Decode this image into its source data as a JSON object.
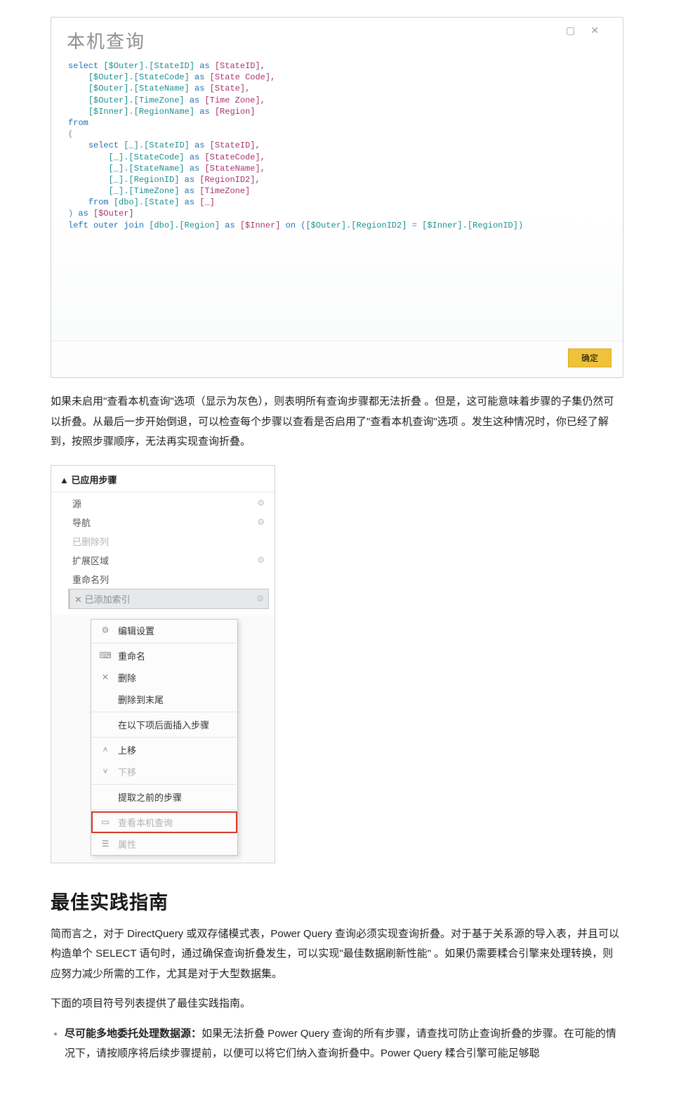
{
  "dialog": {
    "title": "本机查询",
    "win_square": "▢",
    "win_close": "✕",
    "ok_label": "确定",
    "sql": {
      "l01a": "select ",
      "l01b": "[$Outer].[StateID] ",
      "l01c": "as ",
      "l01d": "[StateID],",
      "l02a": "[$Outer].[StateCode] ",
      "l02b": "as ",
      "l02c": "[State Code],",
      "l03a": "[$Outer].[StateName] ",
      "l03b": "as ",
      "l03c": "[State],",
      "l04a": "[$Outer].[TimeZone] ",
      "l04b": "as ",
      "l04c": "[Time Zone],",
      "l05a": "[$Inner].[RegionName] ",
      "l05b": "as ",
      "l05c": "[Region]",
      "l06": "from",
      "l07": "(",
      "l08a": "select ",
      "l08b": "[_].[StateID] ",
      "l08c": "as ",
      "l08d": "[StateID],",
      "l09a": "[_].[StateCode] ",
      "l09b": "as ",
      "l09c": "[StateCode],",
      "l10a": "[_].[StateName] ",
      "l10b": "as ",
      "l10c": "[StateName],",
      "l11a": "[_].[RegionID] ",
      "l11b": "as ",
      "l11c": "[RegionID2],",
      "l12a": "[_].[TimeZone] ",
      "l12b": "as ",
      "l12c": "[TimeZone]",
      "l13a": "from ",
      "l13b": "[dbo].[State] ",
      "l13c": "as ",
      "l13d": "[_]",
      "l14a": ") ",
      "l14b": "as ",
      "l14c": "[$Outer]",
      "l15a": "left outer join ",
      "l15b": "[dbo].[Region] ",
      "l15c": "as ",
      "l15d": "[$Inner] ",
      "l15e": "on (",
      "l15f": "[$Outer].[RegionID2] ",
      "l15g": "= ",
      "l15h": "[$Inner].[RegionID])"
    }
  },
  "para1": "如果未启用\"查看本机查询\"选项（显示为灰色），则表明所有查询步骤都无法折叠 。但是，这可能意味着步骤的子集仍然可以折叠。从最后一步开始倒退，可以检查每个步骤以查看是否启用了\"查看本机查询\"选项 。发生这种情况时，你已经了解到，按照步骤顺序，无法再实现查询折叠。",
  "steps": {
    "header": "▲ 已应用步骤",
    "items": [
      {
        "label": "源",
        "gear": true
      },
      {
        "label": "导航",
        "gear": true
      },
      {
        "label": "已删除列",
        "gear": false,
        "dim": true
      },
      {
        "label": "扩展区域",
        "gear": true
      },
      {
        "label": "重命名列",
        "gear": false
      }
    ],
    "selected_label": "已添加索引",
    "ctx": {
      "edit": "编辑设置",
      "rename": "重命名",
      "delete": "删除",
      "delete_end": "删除到末尾",
      "insert_after": "在以下项后面插入步骤",
      "move_up": "上移",
      "move_down": "下移",
      "extract_prev": "提取之前的步骤",
      "view_native": "查看本机查询",
      "properties": "属性"
    }
  },
  "section_title": "最佳实践指南",
  "para2": "简而言之，对于 DirectQuery 或双存储模式表，Power Query 查询必须实现查询折叠。对于基于关系源的导入表，并且可以构造单个 SELECT 语句时，通过确保查询折叠发生，可以实现\"最佳数据刷新性能\" 。如果仍需要糅合引擎来处理转换，则应努力减少所需的工作，尤其是对于大型数据集。",
  "para3": "下面的项目符号列表提供了最佳实践指南。",
  "bullet1_strong": "尽可能多地委托处理数据源：",
  "bullet1_rest": "如果无法折叠 Power Query 查询的所有步骤，请查找可防止查询折叠的步骤。在可能的情况下，请按顺序将后续步骤提前，以便可以将它们纳入查询折叠中。Power Query 糅合引擎可能足够聪"
}
